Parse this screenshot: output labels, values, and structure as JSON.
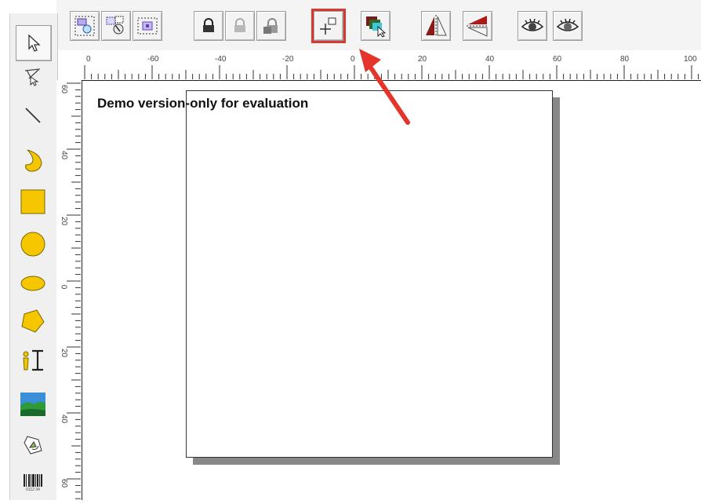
{
  "canvas": {
    "demo_notice": "Demo version-only for evaluation"
  },
  "ruler_h": {
    "labels": [
      "0",
      "-60",
      "-40",
      "-20",
      "0",
      "20",
      "40",
      "60",
      "80",
      "100"
    ]
  },
  "ruler_v": {
    "labels": [
      "60",
      "40",
      "20",
      "0",
      "20",
      "40",
      "60"
    ]
  },
  "toolbar": {
    "buttons": [
      "group-objects",
      "ungroup-objects",
      "select-group",
      "lock",
      "lock-disabled",
      "lock-all",
      "set-origin",
      "bring-forward",
      "flip-horizontal",
      "flip-vertical",
      "show-all",
      "hide"
    ],
    "highlighted": "set-origin"
  },
  "toolbox": {
    "tools": [
      "select",
      "node-edit",
      "line",
      "crescent",
      "rectangle",
      "circle",
      "ellipse",
      "polygon",
      "text",
      "image",
      "rotate",
      "barcode"
    ],
    "barcode_caption": "0112 34"
  },
  "colors": {
    "accent_highlight": "#d9382f",
    "shape_fill": "#f6c600",
    "shape_stroke": "#7a6a00"
  }
}
